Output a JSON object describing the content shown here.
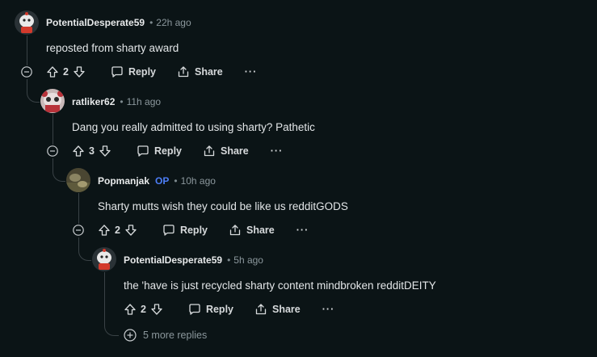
{
  "comments": [
    {
      "username": "PotentialDesperate59",
      "op_badge": "",
      "time": "22h ago",
      "body": "reposted from sharty award",
      "votes": "2",
      "reply_label": "Reply",
      "share_label": "Share",
      "more_label": "···"
    },
    {
      "username": "ratliker62",
      "op_badge": "",
      "time": "11h ago",
      "body": "Dang you really admitted to using sharty? Pathetic",
      "votes": "3",
      "reply_label": "Reply",
      "share_label": "Share",
      "more_label": "···"
    },
    {
      "username": "Popmanjak",
      "op_badge": "OP",
      "time": "10h ago",
      "body": "Sharty mutts wish they could be like us redditGODS",
      "votes": "2",
      "reply_label": "Reply",
      "share_label": "Share",
      "more_label": "···"
    },
    {
      "username": "PotentialDesperate59",
      "op_badge": "",
      "time": "5h ago",
      "body": "the 'have is just recycled sharty content mindbroken redditDEITY",
      "votes": "2",
      "reply_label": "Reply",
      "share_label": "Share",
      "more_label": "···"
    }
  ],
  "more_replies": "5 more replies",
  "dot": "•",
  "icons": {
    "collapse": "minus-circle-icon",
    "upvote": "arrow-up-icon",
    "downvote": "arrow-down-icon",
    "reply": "speech-bubble-icon",
    "share": "share-icon",
    "more_replies": "plus-circle-icon"
  },
  "colors": {
    "background": "#0b1416",
    "op_badge": "#4d7ef7",
    "thread_line": "#3a4246"
  }
}
